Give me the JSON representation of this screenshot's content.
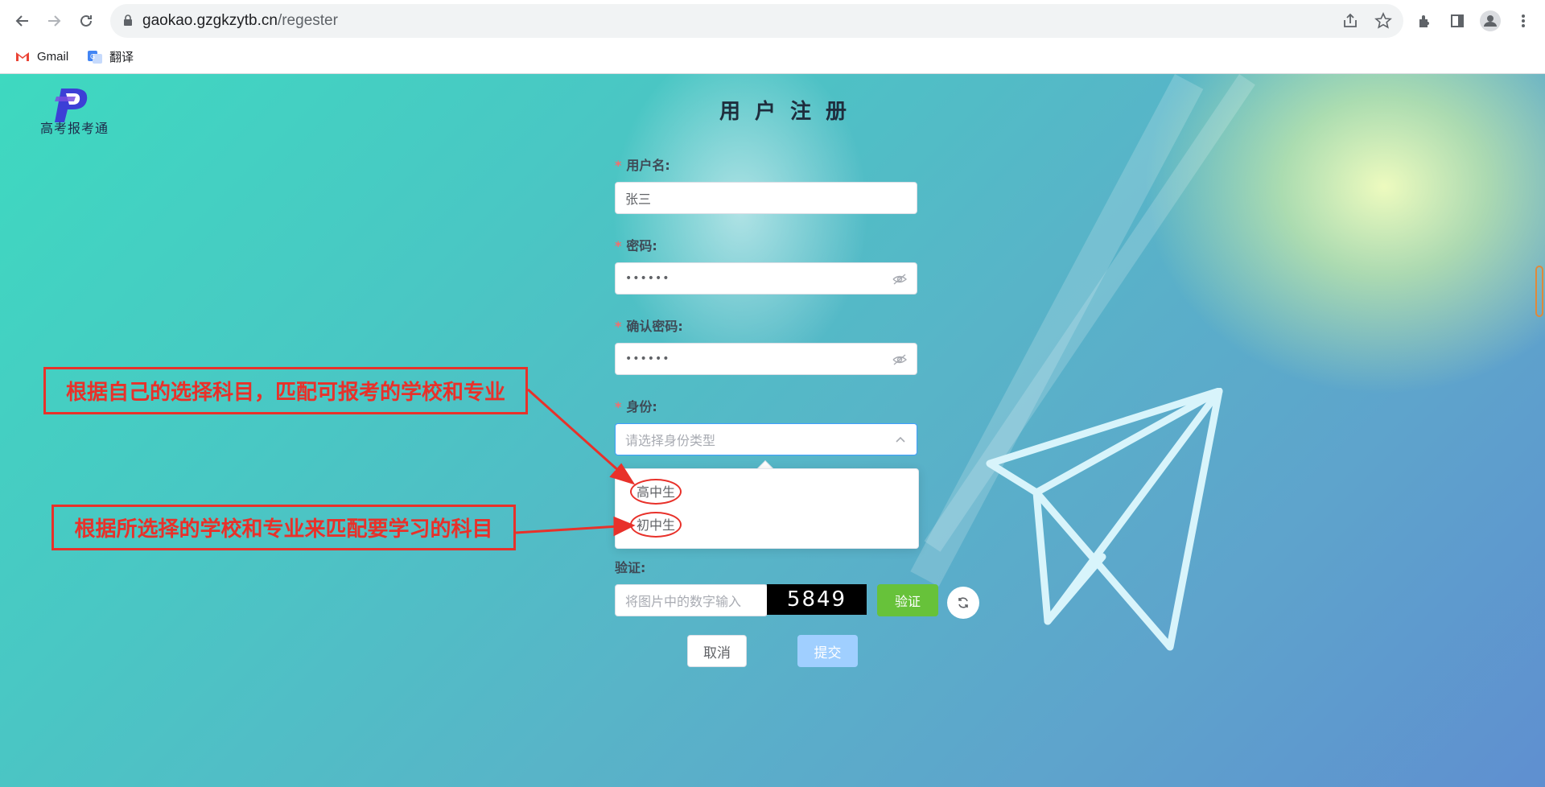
{
  "browser": {
    "url_host": "gaokao.gzgkzytb.cn",
    "url_path": "/regester",
    "bookmarks": [
      {
        "label": "Gmail",
        "icon": "gmail-icon"
      },
      {
        "label": "翻译",
        "icon": "google-translate-icon"
      }
    ]
  },
  "page": {
    "logo_text": "高考报考通",
    "title": "用户注册"
  },
  "form": {
    "username": {
      "label": "用户名:",
      "value": "张三"
    },
    "password": {
      "label": "密码:",
      "value": "••••••"
    },
    "confirm_password": {
      "label": "确认密码:",
      "value": "••••••"
    },
    "identity": {
      "label": "身份:",
      "placeholder": "请选择身份类型",
      "options": [
        "高中生",
        "初中生"
      ]
    },
    "captcha": {
      "label": "验证:",
      "placeholder": "将图片中的数字输入",
      "code": "5849",
      "verify_label": "验证"
    },
    "cancel_label": "取消",
    "submit_label": "提交"
  },
  "annotations": {
    "note_1": "根据自己的选择科目，匹配可报考的学校和专业",
    "note_2": "根据所选择的学校和专业来匹配要学习的科目"
  },
  "colors": {
    "required_star": "#f56c6c",
    "annotation_red": "#e8312a",
    "verify_green": "#67c23a",
    "submit_disabled": "#a0cfff",
    "focus_blue": "#409eff"
  }
}
